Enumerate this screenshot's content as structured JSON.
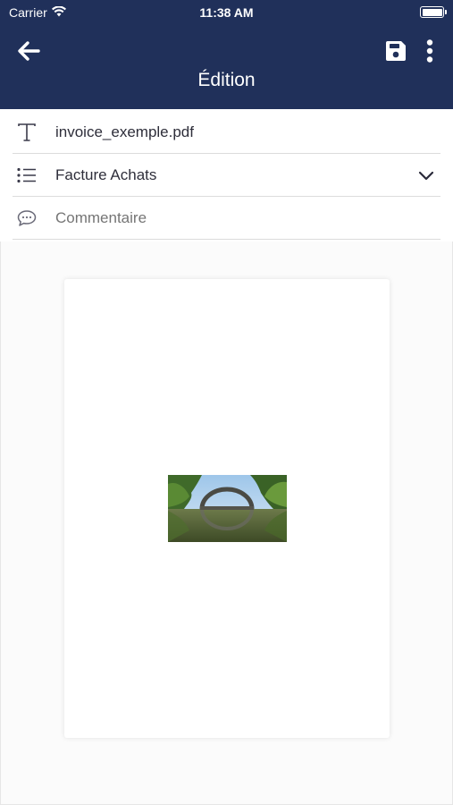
{
  "status_bar": {
    "carrier": "Carrier",
    "time": "11:38 AM"
  },
  "header": {
    "title": "Édition",
    "back_icon": "arrow-left-icon",
    "save_icon": "floppy-disk-icon",
    "more_icon": "more-vertical-icon"
  },
  "form": {
    "filename": "invoice_exemple.pdf",
    "category": "Facture Achats",
    "comment_placeholder": "Commentaire",
    "comment_value": ""
  },
  "preview": {
    "image_alt": "photo-bridge-reflection"
  },
  "colors": {
    "header_bg": "#20305a",
    "text": "#2e2e3a",
    "placeholder": "#a8a8a8",
    "divider": "#dcdcdc"
  }
}
